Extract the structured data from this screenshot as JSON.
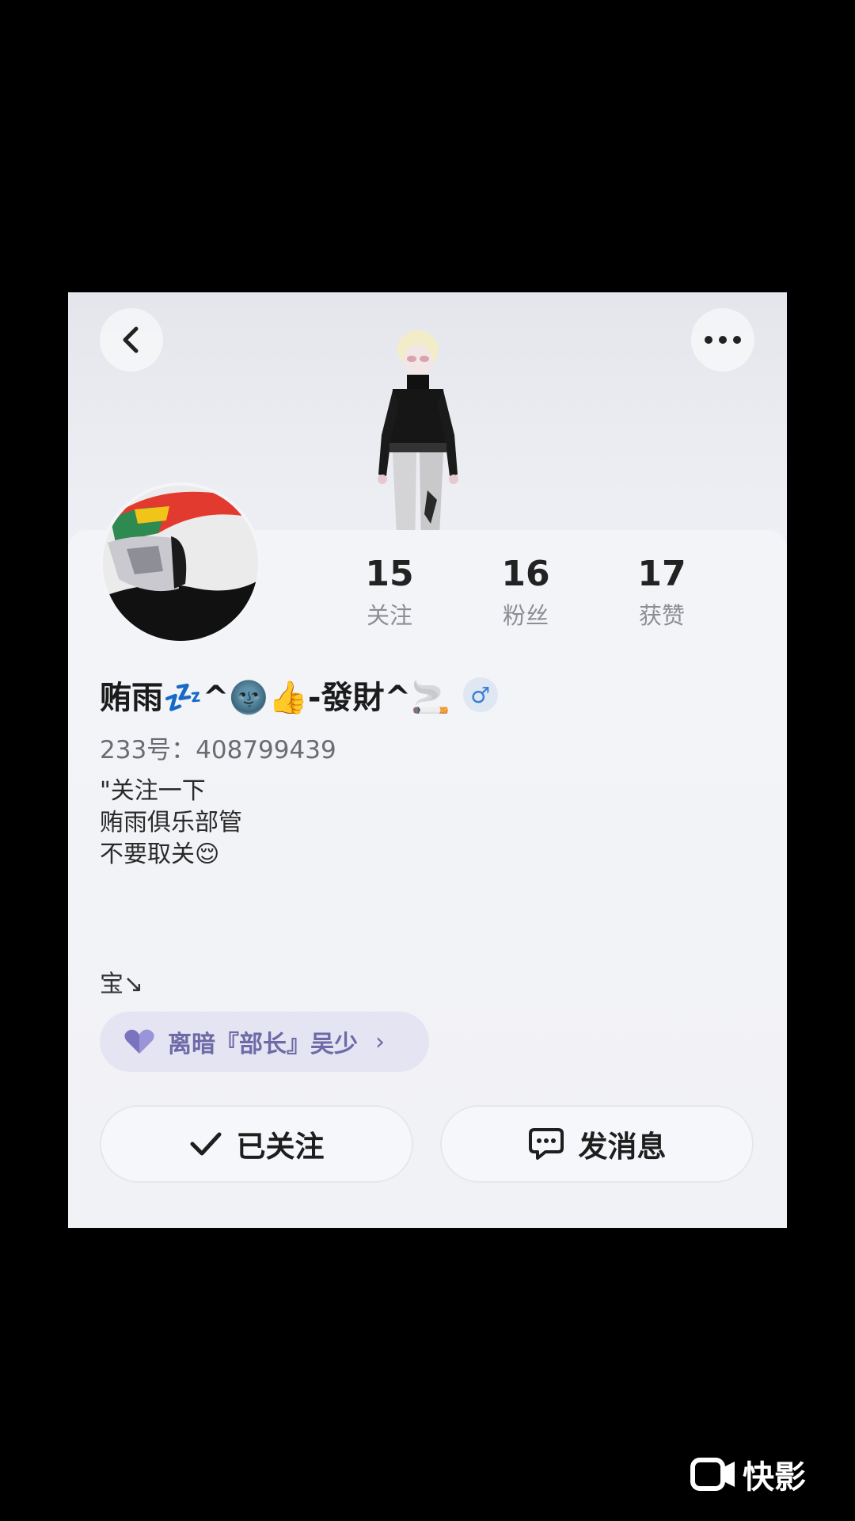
{
  "profile": {
    "name": "贿雨💤^🌚👍-發財^🚬",
    "gender_symbol": "♂",
    "id_line": "233号：408799439",
    "bio_lines": [
      "\"关注一下",
      "贿雨俱乐部管",
      "不要取关😌"
    ],
    "bio_extra": "宝↘"
  },
  "stats": [
    {
      "value": "15",
      "label": "关注"
    },
    {
      "value": "16",
      "label": "粉丝"
    },
    {
      "value": "17",
      "label": "获赞"
    }
  ],
  "relation": {
    "label": "离暗『部长』吴少",
    "chevron": "›"
  },
  "actions": {
    "follow_label": "已关注",
    "message_label": "发消息"
  },
  "watermark": {
    "text": "快影"
  },
  "icons": {
    "back": "chevron-left-icon",
    "more": "ellipsis-icon",
    "heart": "heart-icon",
    "check": "checkmark-icon",
    "message": "chat-bubble-icon",
    "logo": "video-camera-icon"
  },
  "colors": {
    "accent_purple": "#6e6aa8",
    "gender_blue": "#3d7fd6"
  }
}
